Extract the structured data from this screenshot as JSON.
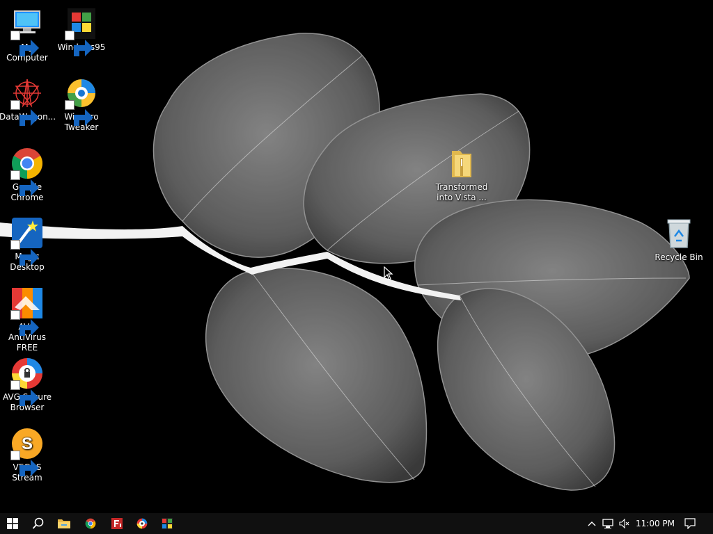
{
  "desktop": {
    "icons": [
      {
        "label": "My Computer",
        "icon": "computer-icon"
      },
      {
        "label": "Windows95",
        "icon": "windows95-icon"
      },
      {
        "label": "DataWagon...",
        "icon": "datawagon-icon"
      },
      {
        "label": "Winaero\nTweaker",
        "icon": "winaero-tweaker-icon"
      },
      {
        "label": "Google\nChrome",
        "icon": "chrome-icon"
      },
      {
        "label": "Magic\nDesktop",
        "icon": "magic-desktop-icon"
      },
      {
        "label": "AVG AntiVirus\nFREE",
        "icon": "avg-antivirus-icon"
      },
      {
        "label": "AVG Secure\nBrowser",
        "icon": "avg-secure-browser-icon"
      },
      {
        "label": "VEGAS\nStream",
        "icon": "vegas-stream-icon"
      },
      {
        "label": "Transformed\ninto Vista ...",
        "icon": "folder-icon"
      },
      {
        "label": "Recycle Bin",
        "icon": "recycle-bin-icon"
      }
    ]
  },
  "taskbar": {
    "items": [
      "windows-start-icon",
      "search-icon",
      "file-explorer-icon",
      "chrome-icon",
      "flashget-icon",
      "avg-browser-icon",
      "app-grid-icon"
    ],
    "tray": [
      "chevron-up-icon",
      "network-icon",
      "speaker-muted-icon",
      "notification-icon"
    ],
    "clock": "11:00 PM"
  },
  "colors": {
    "background": "#000000",
    "taskbar": "#101010",
    "leaf": "#8a8a8a"
  }
}
